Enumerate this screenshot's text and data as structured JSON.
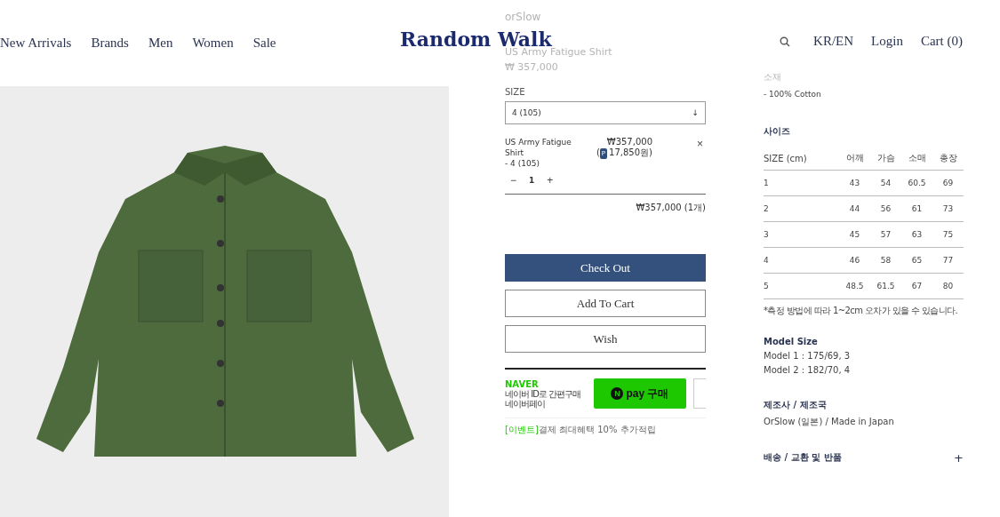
{
  "header": {
    "nav": [
      "New Arrivals",
      "Brands",
      "Men",
      "Women",
      "Sale"
    ],
    "logo": "Random Walk",
    "utility": [
      "KR/EN",
      "Login",
      "Cart (0)"
    ]
  },
  "product": {
    "brand": "orSlow",
    "title": "US Army Fatigue Shirt",
    "price": "₩ 357,000",
    "size_label": "SIZE",
    "size_select": {
      "value": "4 (105)",
      "icon": "↓"
    },
    "cart_item": {
      "name": "US Army Fatigue Shirt",
      "option": "- 4 (105)",
      "price": "₩357,000",
      "points_badge": "P",
      "points": "17,850원)",
      "points_open": "(",
      "quantity": "1",
      "minus": "−",
      "plus": "+",
      "remove": "×"
    },
    "total": "₩357,000 (1개)",
    "buttons": [
      {
        "label": "Check Out",
        "kind": "primary"
      },
      {
        "label": "Add To Cart",
        "kind": "outline"
      },
      {
        "label": "Wish",
        "kind": "outline"
      }
    ],
    "naver": {
      "brand": "NAVER",
      "line1": "네이버 ID로 간편구매",
      "line2": "네이버페이",
      "pay_badge": "N",
      "pay_label": "pay 구매",
      "event_tag": "[이벤트]",
      "event_text": "결제 최대혜택 10% 추가적립"
    }
  },
  "details": {
    "material_label": "소재",
    "material": "- 100% Cotton",
    "size_title": "사이즈",
    "size_table": {
      "columns": [
        "SIZE (cm)",
        "어깨",
        "가슴",
        "소매",
        "총장"
      ],
      "rows": [
        [
          "1",
          "43",
          "54",
          "60.5",
          "69"
        ],
        [
          "2",
          "44",
          "56",
          "61",
          "73"
        ],
        [
          "3",
          "45",
          "57",
          "63",
          "75"
        ],
        [
          "4",
          "46",
          "58",
          "65",
          "77"
        ],
        [
          "5",
          "48.5",
          "61.5",
          "67",
          "80"
        ]
      ]
    },
    "note": "*측정 방법에 따라 1~2cm 오차가 있을 수 있습니다.",
    "model_title": "Model Size",
    "models": [
      "Model 1 : 175/69, 3",
      "Model 2 : 182/70, 4"
    ],
    "maker_title": "제조사 / 제조국",
    "maker": "OrSlow (일본) / Made in Japan",
    "shipping": {
      "title": "배송 / 교환 및 반품",
      "icon": "+",
      "expanded": false
    }
  }
}
